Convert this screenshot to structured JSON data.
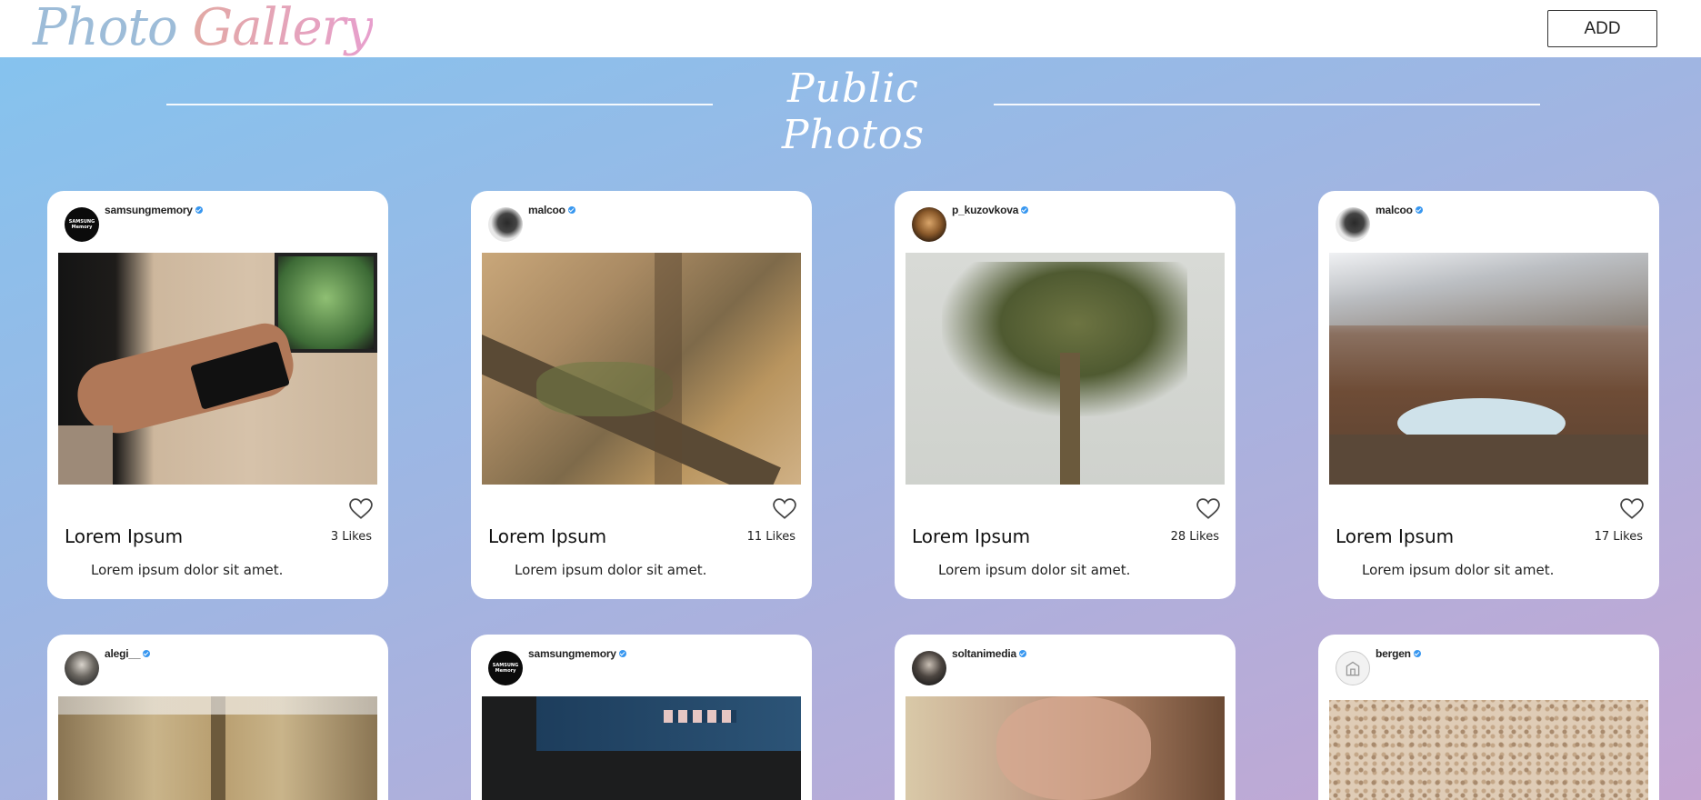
{
  "header": {
    "logo_word1": "Photo",
    "logo_word2": "Gallery",
    "add_label": "ADD"
  },
  "section": {
    "title": "Public Photos"
  },
  "cards": [
    {
      "username": "samsungmemory",
      "title": "Lorem Ipsum",
      "likes": "3 Likes",
      "description": "Lorem ipsum dolor sit amet."
    },
    {
      "username": "malcoo",
      "title": "Lorem Ipsum",
      "likes": "11 Likes",
      "description": "Lorem ipsum dolor sit amet."
    },
    {
      "username": "p_kuzovkova",
      "title": "Lorem Ipsum",
      "likes": "28 Likes",
      "description": "Lorem ipsum dolor sit amet."
    },
    {
      "username": "malcoo",
      "title": "Lorem Ipsum",
      "likes": "17 Likes",
      "description": "Lorem ipsum dolor sit amet."
    },
    {
      "username": "alegi__",
      "title": "",
      "likes": "",
      "description": ""
    },
    {
      "username": "samsungmemory",
      "title": "",
      "likes": "",
      "description": ""
    },
    {
      "username": "soltanimedia",
      "title": "",
      "likes": "",
      "description": ""
    },
    {
      "username": "bergen",
      "title": "",
      "likes": "",
      "description": ""
    }
  ],
  "colors": {
    "verified": "#3897f0",
    "heart_outline": "#444444"
  }
}
